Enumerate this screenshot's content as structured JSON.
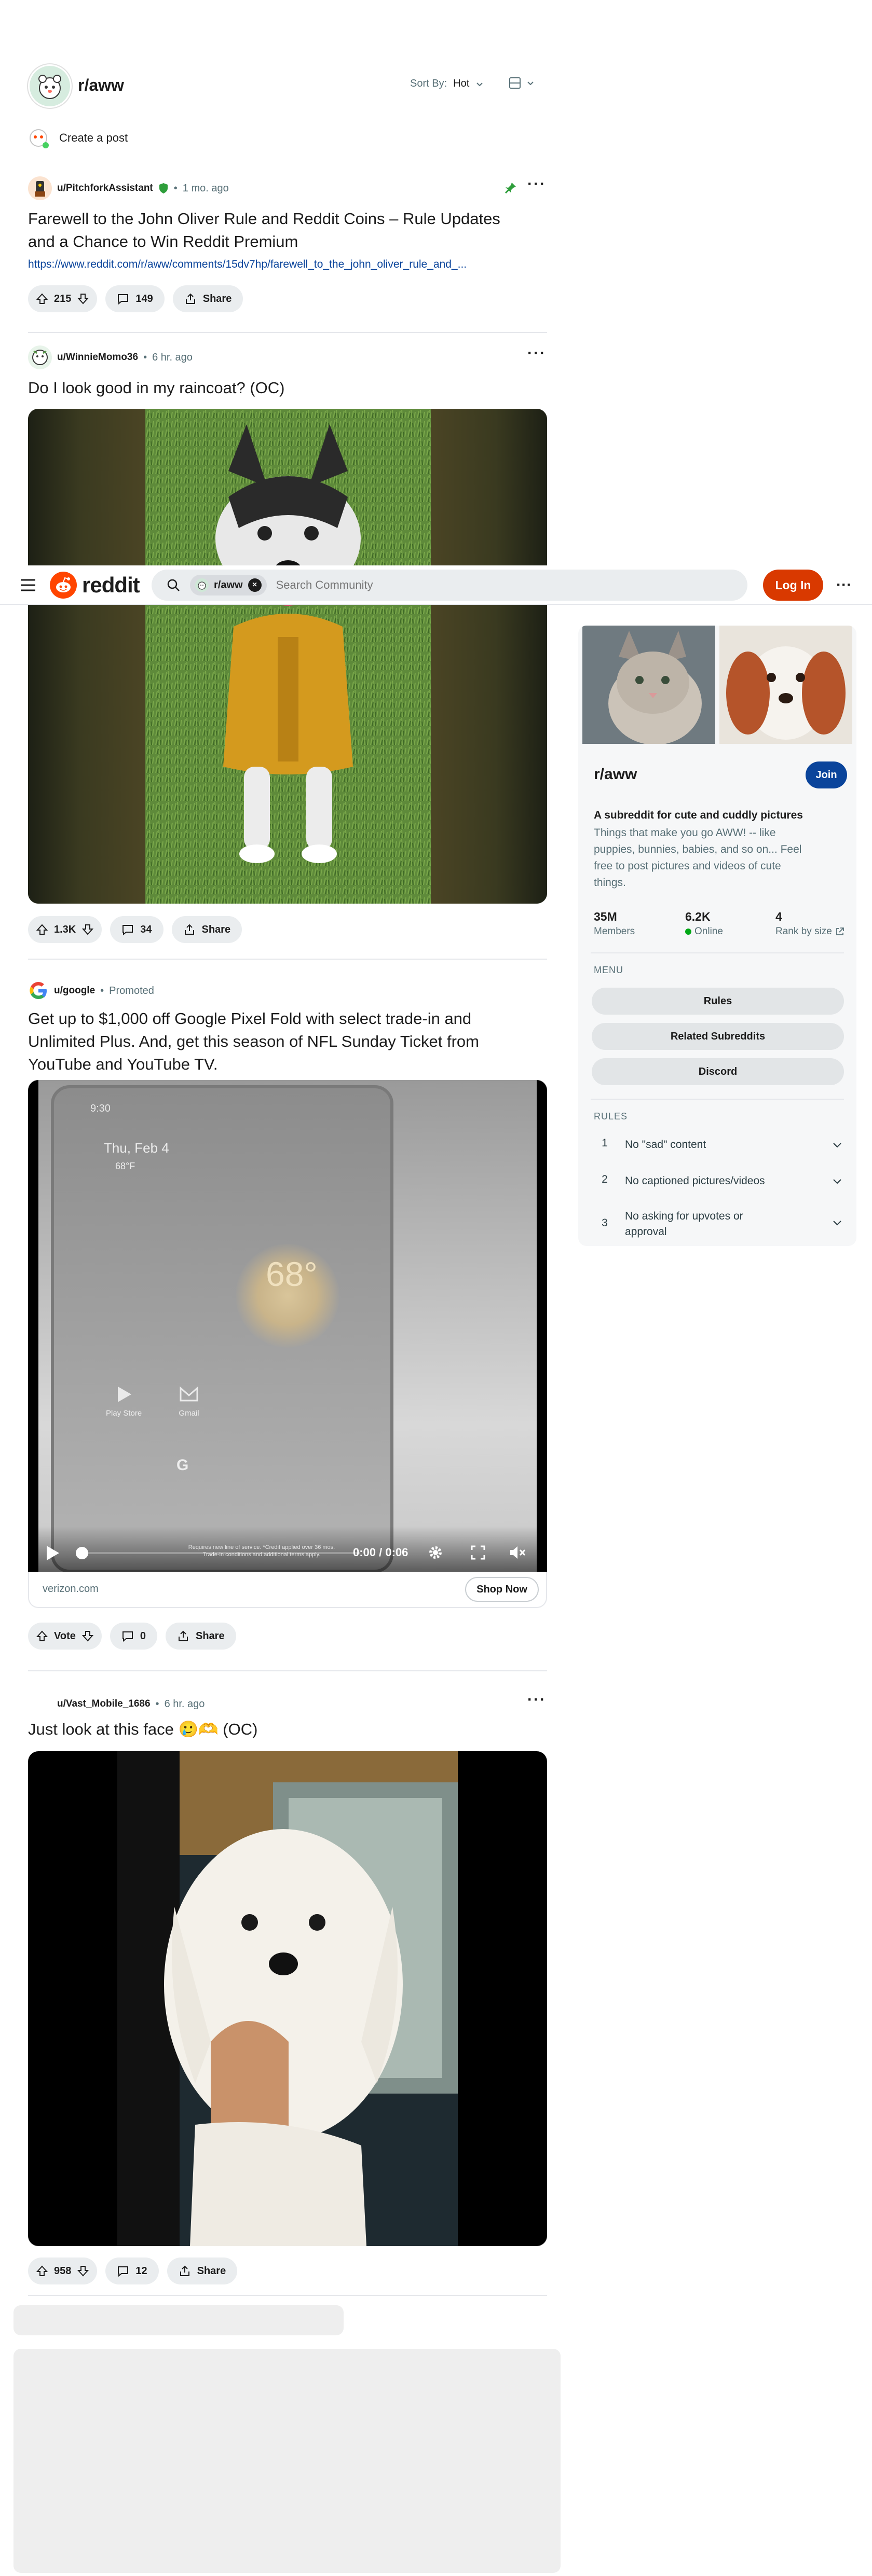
{
  "subreddit_header": {
    "name": "r/aww",
    "sort_label": "Sort By:",
    "sort_value": "Hot",
    "create_post": "Create a post"
  },
  "top_nav": {
    "brand": "reddit",
    "search_chip": "r/aww",
    "search_placeholder": "Search Community",
    "login": "Log In"
  },
  "posts": [
    {
      "author": "u/PitchforkAssistant",
      "age": "1 mo. ago",
      "title_line1": "Farewell to the John Oliver Rule and Reddit Coins – Rule Updates",
      "title_line2": "and a Chance to Win Reddit Premium",
      "link": "https://www.reddit.com/r/aww/comments/15dv7hp/farewell_to_the_john_oliver_rule_and_...",
      "votes": "215",
      "comments": "149",
      "share": "Share"
    },
    {
      "author": "u/WinnieMomo36",
      "age": "6 hr. ago",
      "title": "Do I look good in my raincoat? (OC)",
      "votes": "1.3K",
      "comments": "34",
      "share": "Share"
    },
    {
      "author": "u/google",
      "promoted": "Promoted",
      "title_line1": "Get up to $1,000 off Google Pixel Fold with select trade-in and",
      "title_line2": "Unlimited Plus. And, get this season of NFL Sunday Ticket from",
      "title_line3": "YouTube and YouTube TV.",
      "video_time": "0:00 / 0:06",
      "phone_clock": "9:30",
      "phone_date": "Thu, Feb 4",
      "phone_weather": "68°",
      "phone_temp_small": "68°F",
      "app_play": "Play Store",
      "app_gmail": "Gmail",
      "fine_print_1": "Requires new line of service. *Credit applied over 36 mos.",
      "fine_print_2": "Trade-in conditions and additional terms apply.",
      "domain": "verizon.com",
      "cta": "Shop Now",
      "votes": "Vote",
      "comments": "0",
      "share": "Share"
    },
    {
      "author": "u/Vast_Mobile_1686",
      "age": "6 hr. ago",
      "title": "Just look at this face 🥲🫶 (OC)",
      "votes": "958",
      "comments": "12",
      "share": "Share"
    }
  ],
  "sidebar": {
    "title": "r/aww",
    "join": "Join",
    "desc_title": "A subreddit for cute and cuddly pictures",
    "desc_line1": "Things that make you go AWW! -- like",
    "desc_line2": "puppies, bunnies, babies, and so on... Feel",
    "desc_line3": "free to post pictures and videos of cute",
    "desc_line4": "things.",
    "stats": [
      {
        "value": "35M",
        "label": "Members"
      },
      {
        "value": "6.2K",
        "label": "Online"
      },
      {
        "value": "4",
        "label": "Rank by size"
      }
    ],
    "menu_heading": "MENU",
    "menu": [
      "Rules",
      "Related Subreddits",
      "Discord"
    ],
    "rules_heading": "RULES",
    "rules": [
      {
        "num": "1",
        "text": "No \"sad\" content"
      },
      {
        "num": "2",
        "text": "No captioned pictures/videos"
      },
      {
        "num": "3",
        "text_line1": "No asking for upvotes or",
        "text_line2": "approval"
      }
    ]
  },
  "colors": {
    "brand_orange": "#ff4500",
    "login_bg": "#d93900",
    "join_bg": "#0a449b",
    "link_blue": "#0a449b",
    "online_green": "#01a816",
    "mod_shield": "#2e9e3b"
  }
}
